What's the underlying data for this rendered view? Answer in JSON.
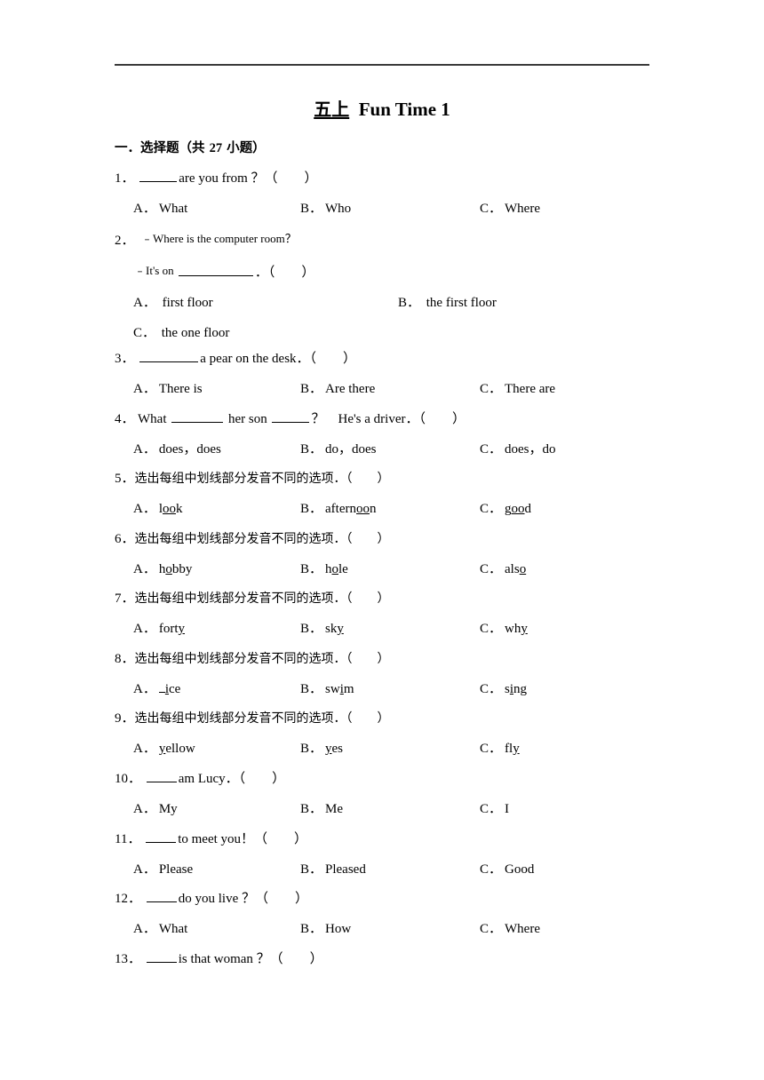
{
  "document": {
    "title_cn": "五上",
    "title_en": "Fun Time 1",
    "section_heading_pre": "一．选择题（共 ",
    "section_count": "27",
    "section_heading_post": " 小题）"
  },
  "questions": [
    {
      "number": "1．",
      "stem_before": "",
      "stem_after": "are you from ？（　　）",
      "options": [
        {
          "marker": "A．",
          "text": "What"
        },
        {
          "marker": "B．",
          "text": "Who"
        },
        {
          "marker": "C．",
          "text": "Where"
        }
      ]
    },
    {
      "number": "2．",
      "line1": "﹣Where is the computer room？",
      "line2_before": "﹣It's on ",
      "line2_after": "．（　　）",
      "options": [
        {
          "marker": "A．",
          "text": "first floor"
        },
        {
          "marker": "B．",
          "text": "the first floor"
        },
        {
          "marker": "C．",
          "text": "the one floor"
        }
      ]
    },
    {
      "number": "3．",
      "stem_after": "a pear on the desk．（　　）",
      "options": [
        {
          "marker": "A．",
          "text": "There is"
        },
        {
          "marker": "B．",
          "text": "Are there"
        },
        {
          "marker": "C．",
          "text": "There are"
        }
      ]
    },
    {
      "number": "4．",
      "stem_p1": "What ",
      "stem_p2": " her son ",
      "stem_p3": "？　He's a driver．（　　）",
      "options": [
        {
          "marker": "A．",
          "text": "does，does"
        },
        {
          "marker": "B．",
          "text": "do，does"
        },
        {
          "marker": "C．",
          "text": "does，do"
        }
      ]
    },
    {
      "number": "5．",
      "stem_cn": "选出每组中划线部分发音不同的选项．（　　）",
      "options": [
        {
          "marker": "A．",
          "pre": "l",
          "mid": "oo",
          "post": "k"
        },
        {
          "marker": "B．",
          "pre": "aftern",
          "mid": "oo",
          "post": "n"
        },
        {
          "marker": "C．",
          "pre": "g",
          "mid": "oo",
          "post": "d"
        }
      ]
    },
    {
      "number": "6．",
      "stem_cn": "选出每组中划线部分发音不同的选项．（　　）",
      "options": [
        {
          "marker": "A．",
          "pre": "h",
          "mid": "o",
          "post": "bby"
        },
        {
          "marker": "B．",
          "pre": "h",
          "mid": "o",
          "post": "le"
        },
        {
          "marker": "C．",
          "pre": "als",
          "mid": "o",
          "post": ""
        }
      ]
    },
    {
      "number": "7．",
      "stem_cn": "选出每组中划线部分发音不同的选项．（　　）",
      "options": [
        {
          "marker": "A．",
          "pre": "fort",
          "mid": "y",
          "post": ""
        },
        {
          "marker": "B．",
          "pre": "sk",
          "mid": "y",
          "post": ""
        },
        {
          "marker": "C．",
          "pre": "wh",
          "mid": "y",
          "post": ""
        }
      ]
    },
    {
      "number": "8．",
      "stem_cn": "选出每组中划线部分发音不同的选项．（　　）",
      "options": [
        {
          "marker": "A．",
          "pre": "",
          "mid": "i",
          "post": "ce",
          "lead_underline": true
        },
        {
          "marker": "B．",
          "pre": "sw",
          "mid": "i",
          "post": "m"
        },
        {
          "marker": "C．",
          "pre": "s",
          "mid": "i",
          "post": "ng"
        }
      ]
    },
    {
      "number": "9．",
      "stem_cn": "选出每组中划线部分发音不同的选项．（　　）",
      "options": [
        {
          "marker": "A．",
          "pre": "",
          "mid": "y",
          "post": "ellow"
        },
        {
          "marker": "B．",
          "pre": "",
          "mid": "y",
          "post": "es"
        },
        {
          "marker": "C．",
          "pre": "fl",
          "mid": "y",
          "post": ""
        }
      ]
    },
    {
      "number": "10．",
      "stem_after": "am Lucy．（　　）",
      "options": [
        {
          "marker": "A．",
          "text": "My"
        },
        {
          "marker": "B．",
          "text": "Me"
        },
        {
          "marker": "C．",
          "text": "I"
        }
      ]
    },
    {
      "number": "11．",
      "stem_after": "to meet you！（　　）",
      "options": [
        {
          "marker": "A．",
          "text": "Please"
        },
        {
          "marker": "B．",
          "text": "Pleased"
        },
        {
          "marker": "C．",
          "text": "Good"
        }
      ]
    },
    {
      "number": "12．",
      "stem_after": "do you live ？（　　）",
      "options": [
        {
          "marker": "A．",
          "text": "What"
        },
        {
          "marker": "B．",
          "text": "How"
        },
        {
          "marker": "C．",
          "text": "Where"
        }
      ]
    },
    {
      "number": "13．",
      "stem_after": "is that woman ？（　　）",
      "options": []
    }
  ]
}
